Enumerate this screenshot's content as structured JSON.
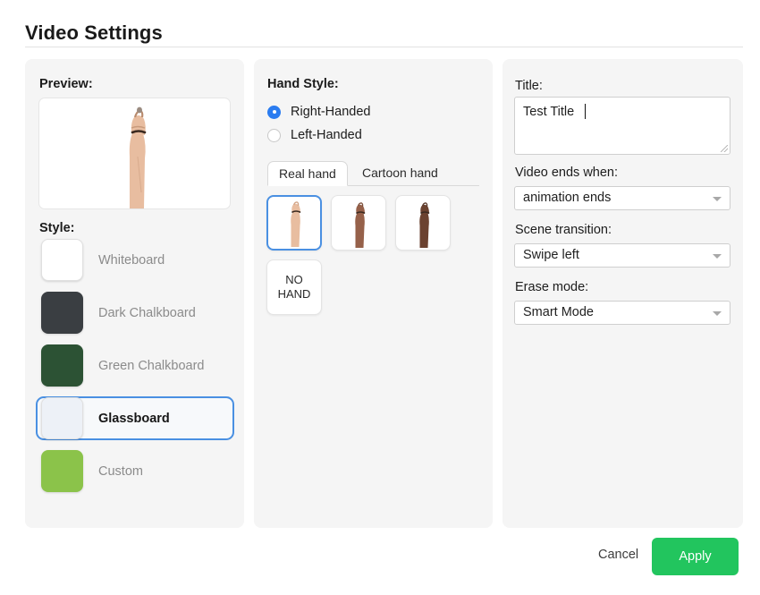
{
  "header": {
    "title": "Video Settings"
  },
  "preview": {
    "heading": "Preview:",
    "style_heading": "Style:",
    "styles": [
      {
        "name": "Whiteboard",
        "color": "#ffffff",
        "selected": false
      },
      {
        "name": "Dark Chalkboard",
        "color": "#3a3e42",
        "selected": false
      },
      {
        "name": "Green Chalkboard",
        "color": "#2c5234",
        "selected": false
      },
      {
        "name": "Glassboard",
        "color": "#edf1f7",
        "selected": true
      },
      {
        "name": "Custom",
        "color": "#8bc34a",
        "selected": false
      }
    ]
  },
  "hand": {
    "heading": "Hand Style:",
    "handedness": [
      {
        "label": "Right-Handed",
        "selected": true
      },
      {
        "label": "Left-Handed",
        "selected": false
      }
    ],
    "tabs": [
      {
        "label": "Real hand",
        "active": true
      },
      {
        "label": "Cartoon hand",
        "active": false
      }
    ],
    "tiles": [
      {
        "type": "hand",
        "skin": "#e8bda0",
        "shade": "#d0a183",
        "selected": true
      },
      {
        "type": "hand",
        "skin": "#96614a",
        "shade": "#7d4f3b",
        "selected": false
      },
      {
        "type": "hand",
        "skin": "#6b4230",
        "shade": "#563526",
        "selected": false
      },
      {
        "type": "text",
        "line1": "NO",
        "line2": "HAND",
        "selected": false
      }
    ]
  },
  "options": {
    "title_label": "Title:",
    "title_value": "Test Title",
    "title_placeholder": "Enter title",
    "ends_label": "Video ends when:",
    "ends_value": "animation ends",
    "scene_label": "Scene transition:",
    "scene_value": "Swipe left",
    "erase_label": "Erase mode:",
    "erase_value": "Smart Mode"
  },
  "footer": {
    "cancel_label": "Cancel",
    "apply_label": "Apply",
    "apply_color": "#22c55e"
  }
}
